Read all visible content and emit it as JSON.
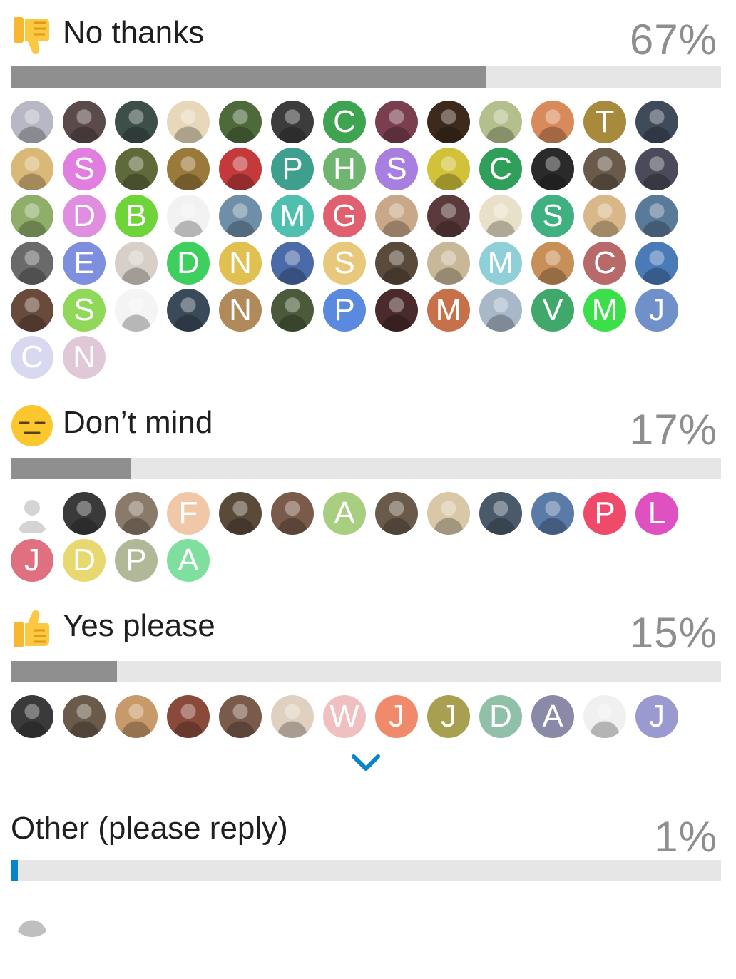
{
  "poll": {
    "options": [
      {
        "label": "No thanks",
        "percent_text": "67%",
        "percent": 67,
        "emoji": "thumbs-down-icon",
        "avatars": [
          {
            "type": "photo",
            "color": "#b8b8c4"
          },
          {
            "type": "photo",
            "color": "#5a4a4a"
          },
          {
            "type": "photo",
            "color": "#3e4f4a"
          },
          {
            "type": "photo",
            "color": "#e8d7b8"
          },
          {
            "type": "photo",
            "color": "#4f6a3a"
          },
          {
            "type": "photo",
            "color": "#3c3c3c"
          },
          {
            "type": "letter",
            "letter": "C",
            "color": "#3ea451"
          },
          {
            "type": "photo",
            "color": "#7a3f4f"
          },
          {
            "type": "photo",
            "color": "#3d2a1c"
          },
          {
            "type": "photo",
            "color": "#b3c08c"
          },
          {
            "type": "photo",
            "color": "#d98a5a"
          },
          {
            "type": "letter",
            "letter": "T",
            "color": "#a88a3c"
          },
          {
            "type": "photo",
            "color": "#3f4a5a"
          },
          {
            "type": "photo",
            "color": "#d9b878"
          },
          {
            "type": "letter",
            "letter": "S",
            "color": "#e07fe0"
          },
          {
            "type": "photo",
            "color": "#5f6a3a"
          },
          {
            "type": "photo",
            "color": "#9a7a3a"
          },
          {
            "type": "photo",
            "color": "#c43a3a"
          },
          {
            "type": "letter",
            "letter": "P",
            "color": "#3f9f8f"
          },
          {
            "type": "letter",
            "letter": "H",
            "color": "#6fb46f"
          },
          {
            "type": "letter",
            "letter": "S",
            "color": "#a87fe0"
          },
          {
            "type": "photo",
            "color": "#d2c23a"
          },
          {
            "type": "letter",
            "letter": "C",
            "color": "#2f9f5a"
          },
          {
            "type": "photo",
            "color": "#2a2a2a"
          },
          {
            "type": "photo",
            "color": "#6a5a4a"
          },
          {
            "type": "photo",
            "color": "#4a4a5a"
          },
          {
            "type": "photo",
            "color": "#8fae6a"
          },
          {
            "type": "letter",
            "letter": "D",
            "color": "#e08fe0"
          },
          {
            "type": "letter",
            "letter": "B",
            "color": "#6fd43a"
          },
          {
            "type": "photo",
            "color": "#f2f2f2"
          },
          {
            "type": "photo",
            "color": "#6f8fa8"
          },
          {
            "type": "letter",
            "letter": "M",
            "color": "#4fc0b0"
          },
          {
            "type": "letter",
            "letter": "G",
            "color": "#e06070"
          },
          {
            "type": "photo",
            "color": "#c8a888"
          },
          {
            "type": "photo",
            "color": "#5a3a3a"
          },
          {
            "type": "photo",
            "color": "#e8e0c8"
          },
          {
            "type": "letter",
            "letter": "S",
            "color": "#3fb07f"
          },
          {
            "type": "photo",
            "color": "#d8b888"
          },
          {
            "type": "photo",
            "color": "#5a7a9a"
          },
          {
            "type": "photo",
            "color": "#6a6a6a"
          },
          {
            "type": "letter",
            "letter": "E",
            "color": "#7f8fe0"
          },
          {
            "type": "photo",
            "color": "#d8d0c8"
          },
          {
            "type": "letter",
            "letter": "D",
            "color": "#3fcf5f"
          },
          {
            "type": "letter",
            "letter": "N",
            "color": "#e0c050"
          },
          {
            "type": "photo",
            "color": "#4a6aa8"
          },
          {
            "type": "letter",
            "letter": "S",
            "color": "#e8c87a"
          },
          {
            "type": "photo",
            "color": "#5a4a3a"
          },
          {
            "type": "photo",
            "color": "#c8b898"
          },
          {
            "type": "letter",
            "letter": "M",
            "color": "#8fcfd8"
          },
          {
            "type": "photo",
            "color": "#c89058"
          },
          {
            "type": "letter",
            "letter": "C",
            "color": "#b86a6a"
          },
          {
            "type": "photo",
            "color": "#4a7ab8"
          },
          {
            "type": "photo",
            "color": "#6a4a3a"
          },
          {
            "type": "letter",
            "letter": "S",
            "color": "#8fd85a"
          },
          {
            "type": "photo",
            "color": "#f4f4f4"
          },
          {
            "type": "photo",
            "color": "#3a4a5a"
          },
          {
            "type": "letter",
            "letter": "N",
            "color": "#b08a5a"
          },
          {
            "type": "photo",
            "color": "#4a5a3a"
          },
          {
            "type": "letter",
            "letter": "P",
            "color": "#5a8ae0"
          },
          {
            "type": "photo",
            "color": "#4a2a2a"
          },
          {
            "type": "letter",
            "letter": "M",
            "color": "#c8704a"
          },
          {
            "type": "photo",
            "color": "#a8b8c8"
          },
          {
            "type": "letter",
            "letter": "V",
            "color": "#3fa86a"
          },
          {
            "type": "letter",
            "letter": "M",
            "color": "#3adf4a"
          },
          {
            "type": "letter",
            "letter": "J",
            "color": "#6f90c8"
          },
          {
            "type": "letter",
            "letter": "C",
            "color": "#d8d8f0"
          },
          {
            "type": "letter",
            "letter": "N",
            "color": "#e0c8d8"
          }
        ]
      },
      {
        "label": "Don’t mind",
        "percent_text": "17%",
        "percent": 17,
        "emoji": "expressionless-face-icon",
        "avatars": [
          {
            "type": "placeholder",
            "color": "#ffffff"
          },
          {
            "type": "photo",
            "color": "#3a3a3a"
          },
          {
            "type": "photo",
            "color": "#8a7a6a"
          },
          {
            "type": "letter",
            "letter": "F",
            "color": "#f0c8a8"
          },
          {
            "type": "photo",
            "color": "#5a4a3a"
          },
          {
            "type": "photo",
            "color": "#7a5a4a"
          },
          {
            "type": "letter",
            "letter": "A",
            "color": "#a8cf7f"
          },
          {
            "type": "photo",
            "color": "#6a5a4a"
          },
          {
            "type": "photo",
            "color": "#d8c8a8"
          },
          {
            "type": "photo",
            "color": "#4a5a6a"
          },
          {
            "type": "photo",
            "color": "#5a7aa8"
          },
          {
            "type": "letter",
            "letter": "P",
            "color": "#ef4a6a"
          },
          {
            "type": "letter",
            "letter": "L",
            "color": "#df50c0"
          },
          {
            "type": "letter",
            "letter": "J",
            "color": "#e0707f"
          },
          {
            "type": "letter",
            "letter": "D",
            "color": "#e8d870"
          },
          {
            "type": "letter",
            "letter": "P",
            "color": "#b0b898"
          },
          {
            "type": "letter",
            "letter": "A",
            "color": "#7fdf9f"
          }
        ]
      },
      {
        "label": "Yes please",
        "percent_text": "15%",
        "percent": 15,
        "emoji": "thumbs-up-icon",
        "avatars": [
          {
            "type": "photo",
            "color": "#3a3a3a"
          },
          {
            "type": "photo",
            "color": "#6a5a4a"
          },
          {
            "type": "photo",
            "color": "#c89a6a"
          },
          {
            "type": "photo",
            "color": "#8a4a3a"
          },
          {
            "type": "photo",
            "color": "#7a5a4a"
          },
          {
            "type": "photo",
            "color": "#e0d0c0"
          },
          {
            "type": "letter",
            "letter": "W",
            "color": "#f0c0c0"
          },
          {
            "type": "letter",
            "letter": "J",
            "color": "#f08a6a"
          },
          {
            "type": "letter",
            "letter": "J",
            "color": "#a8a050"
          },
          {
            "type": "letter",
            "letter": "D",
            "color": "#90c0a8"
          },
          {
            "type": "letter",
            "letter": "A",
            "color": "#8a8aa8"
          },
          {
            "type": "photo",
            "color": "#f0f0f0"
          },
          {
            "type": "letter",
            "letter": "J",
            "color": "#9a9ad0"
          }
        ]
      },
      {
        "label": "Other (please reply)",
        "percent_text": "1%",
        "percent": 1,
        "emoji": "",
        "avatars": [
          {
            "type": "photo",
            "color": "#ffffff"
          }
        ]
      }
    ],
    "bar_fill_color": "#8f8f8f",
    "bar_fill_color_own": "#0a84c8",
    "bar_track_color": "#e6e6e6",
    "chevron_color": "#0a84c8",
    "expand_icon": "chevron-down-icon"
  }
}
